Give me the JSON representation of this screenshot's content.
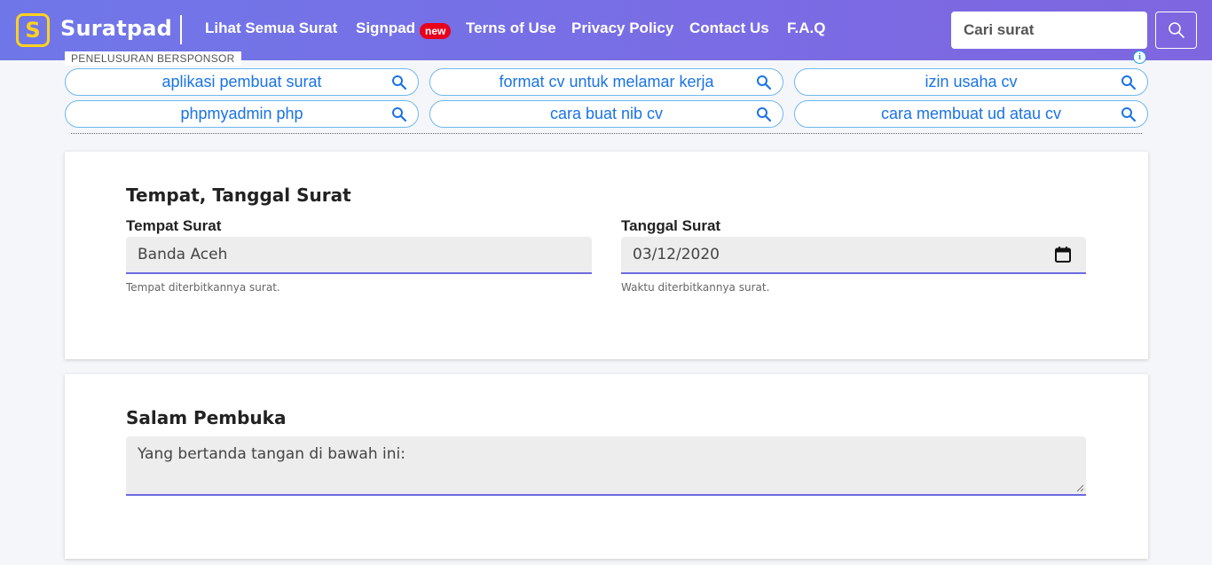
{
  "navbar": {
    "logo_letter": "S",
    "brand": "Suratpad",
    "links": [
      "Lihat Semua Surat",
      "Signpad",
      "Terns of Use",
      "Privacy Policy",
      "Contact Us",
      "F.A.Q"
    ],
    "badge": "new",
    "search_placeholder": "Cari surat",
    "search_icon": "search-icon"
  },
  "ads": {
    "label": "PENELUSURAN BERSPONSOR",
    "info_icon": "info-icon",
    "items": [
      "aplikasi pembuat surat",
      "format cv untuk melamar kerja",
      "izin usaha cv",
      "phpmyadmin php",
      "cara buat nib cv",
      "cara membuat ud atau cv"
    ]
  },
  "section_date": {
    "title": "Tempat, Tanggal Surat",
    "place_label": "Tempat Surat",
    "place_value": "Banda Aceh",
    "place_help": "Tempat diterbitkannya surat.",
    "date_label": "Tanggal Surat",
    "date_value": "03/12/2020",
    "date_help": "Waktu diterbitkannya surat.",
    "calendar_icon": "calendar-icon"
  },
  "section_greeting": {
    "title": "Salam Pembuka",
    "value": "Yang bertanda tangan di bawah ini:"
  },
  "colors": {
    "nav_gradient_start": "#6f77e8",
    "nav_gradient_end": "#7e66e0",
    "logo_yellow": "#ffd21f",
    "badge_red": "#e8001c",
    "ad_link_blue": "#1a73e8",
    "input_underline": "#6b6be0"
  }
}
